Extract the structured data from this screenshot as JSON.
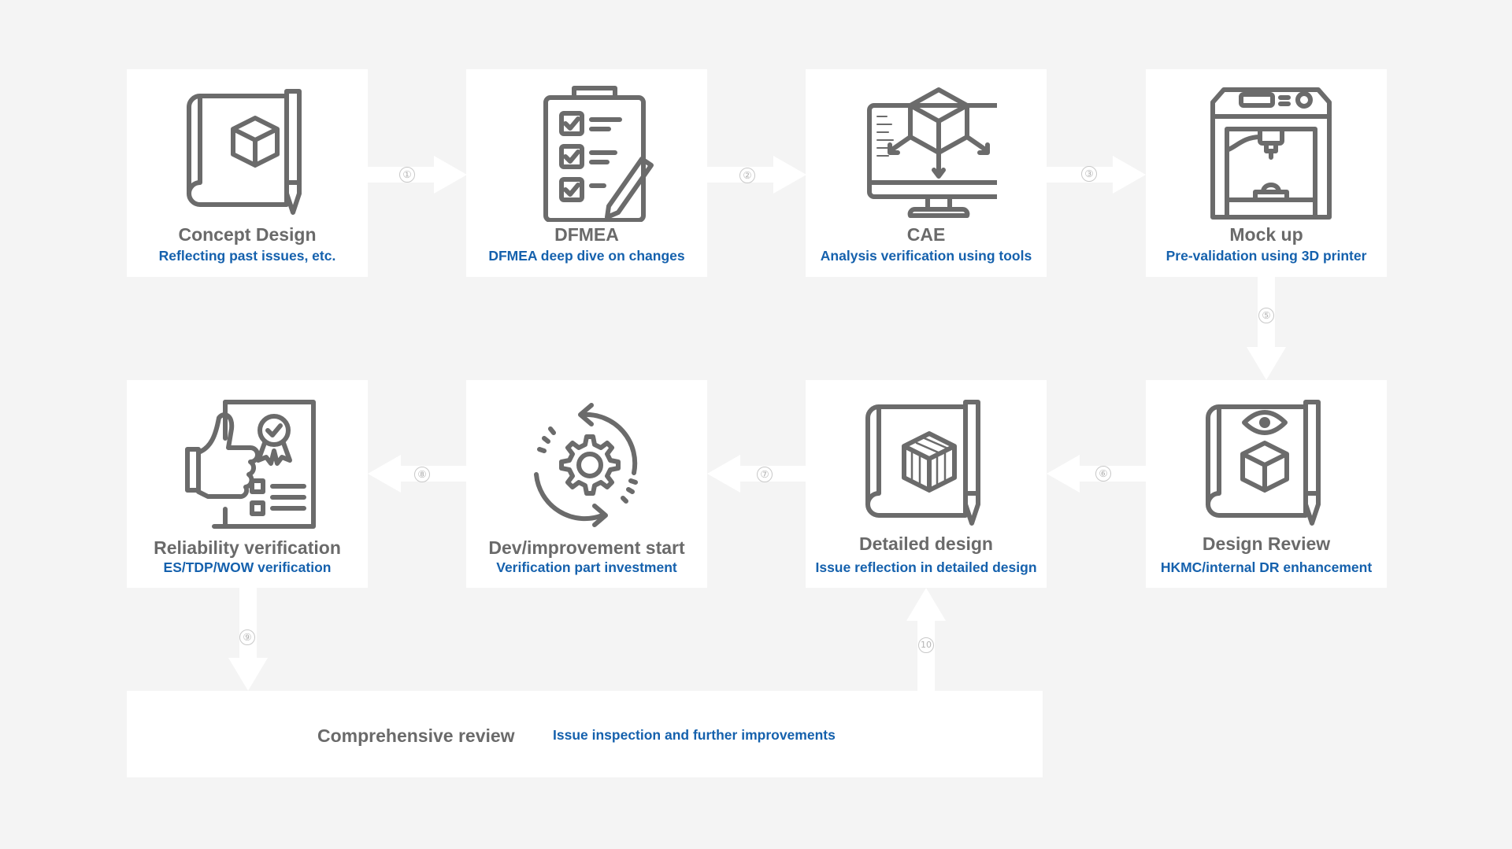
{
  "steps": [
    {
      "title": "Concept Design",
      "subtitle": "Reflecting past issues, etc.",
      "icon": "blueprint-cube-pencil-icon"
    },
    {
      "title": "DFMEA",
      "subtitle": "DFMEA deep dive on changes",
      "icon": "clipboard-checklist-icon"
    },
    {
      "title": "CAE",
      "subtitle": "Analysis verification using tools",
      "icon": "monitor-cube-analysis-icon"
    },
    {
      "title": "Mock up",
      "subtitle": "Pre-validation using 3D printer",
      "icon": "3d-printer-icon"
    },
    {
      "title": "Design Review",
      "subtitle": "HKMC/internal DR enhancement",
      "icon": "blueprint-eye-icon"
    },
    {
      "title": "Detailed design",
      "subtitle": "Issue reflection in detailed design",
      "icon": "blueprint-crate-icon"
    },
    {
      "title": "Dev/improvement start",
      "subtitle": "Verification part investment",
      "icon": "gear-cycle-icon"
    },
    {
      "title": "Reliability verification",
      "subtitle": "ES/TDP/WOW verification",
      "icon": "certificate-thumbs-up-icon"
    }
  ],
  "review": {
    "title": "Comprehensive review",
    "subtitle": "Issue inspection and further improvements"
  },
  "arrows": [
    "①",
    "②",
    "③",
    "⑤",
    "⑥",
    "⑦",
    "⑧",
    "⑨",
    "10"
  ],
  "colors": {
    "background": "#f4f4f4",
    "card": "#ffffff",
    "title": "#6a6a6a",
    "subtitle": "#1561ad",
    "arrow": "#ffffff",
    "icon": "#6b6b6b"
  }
}
